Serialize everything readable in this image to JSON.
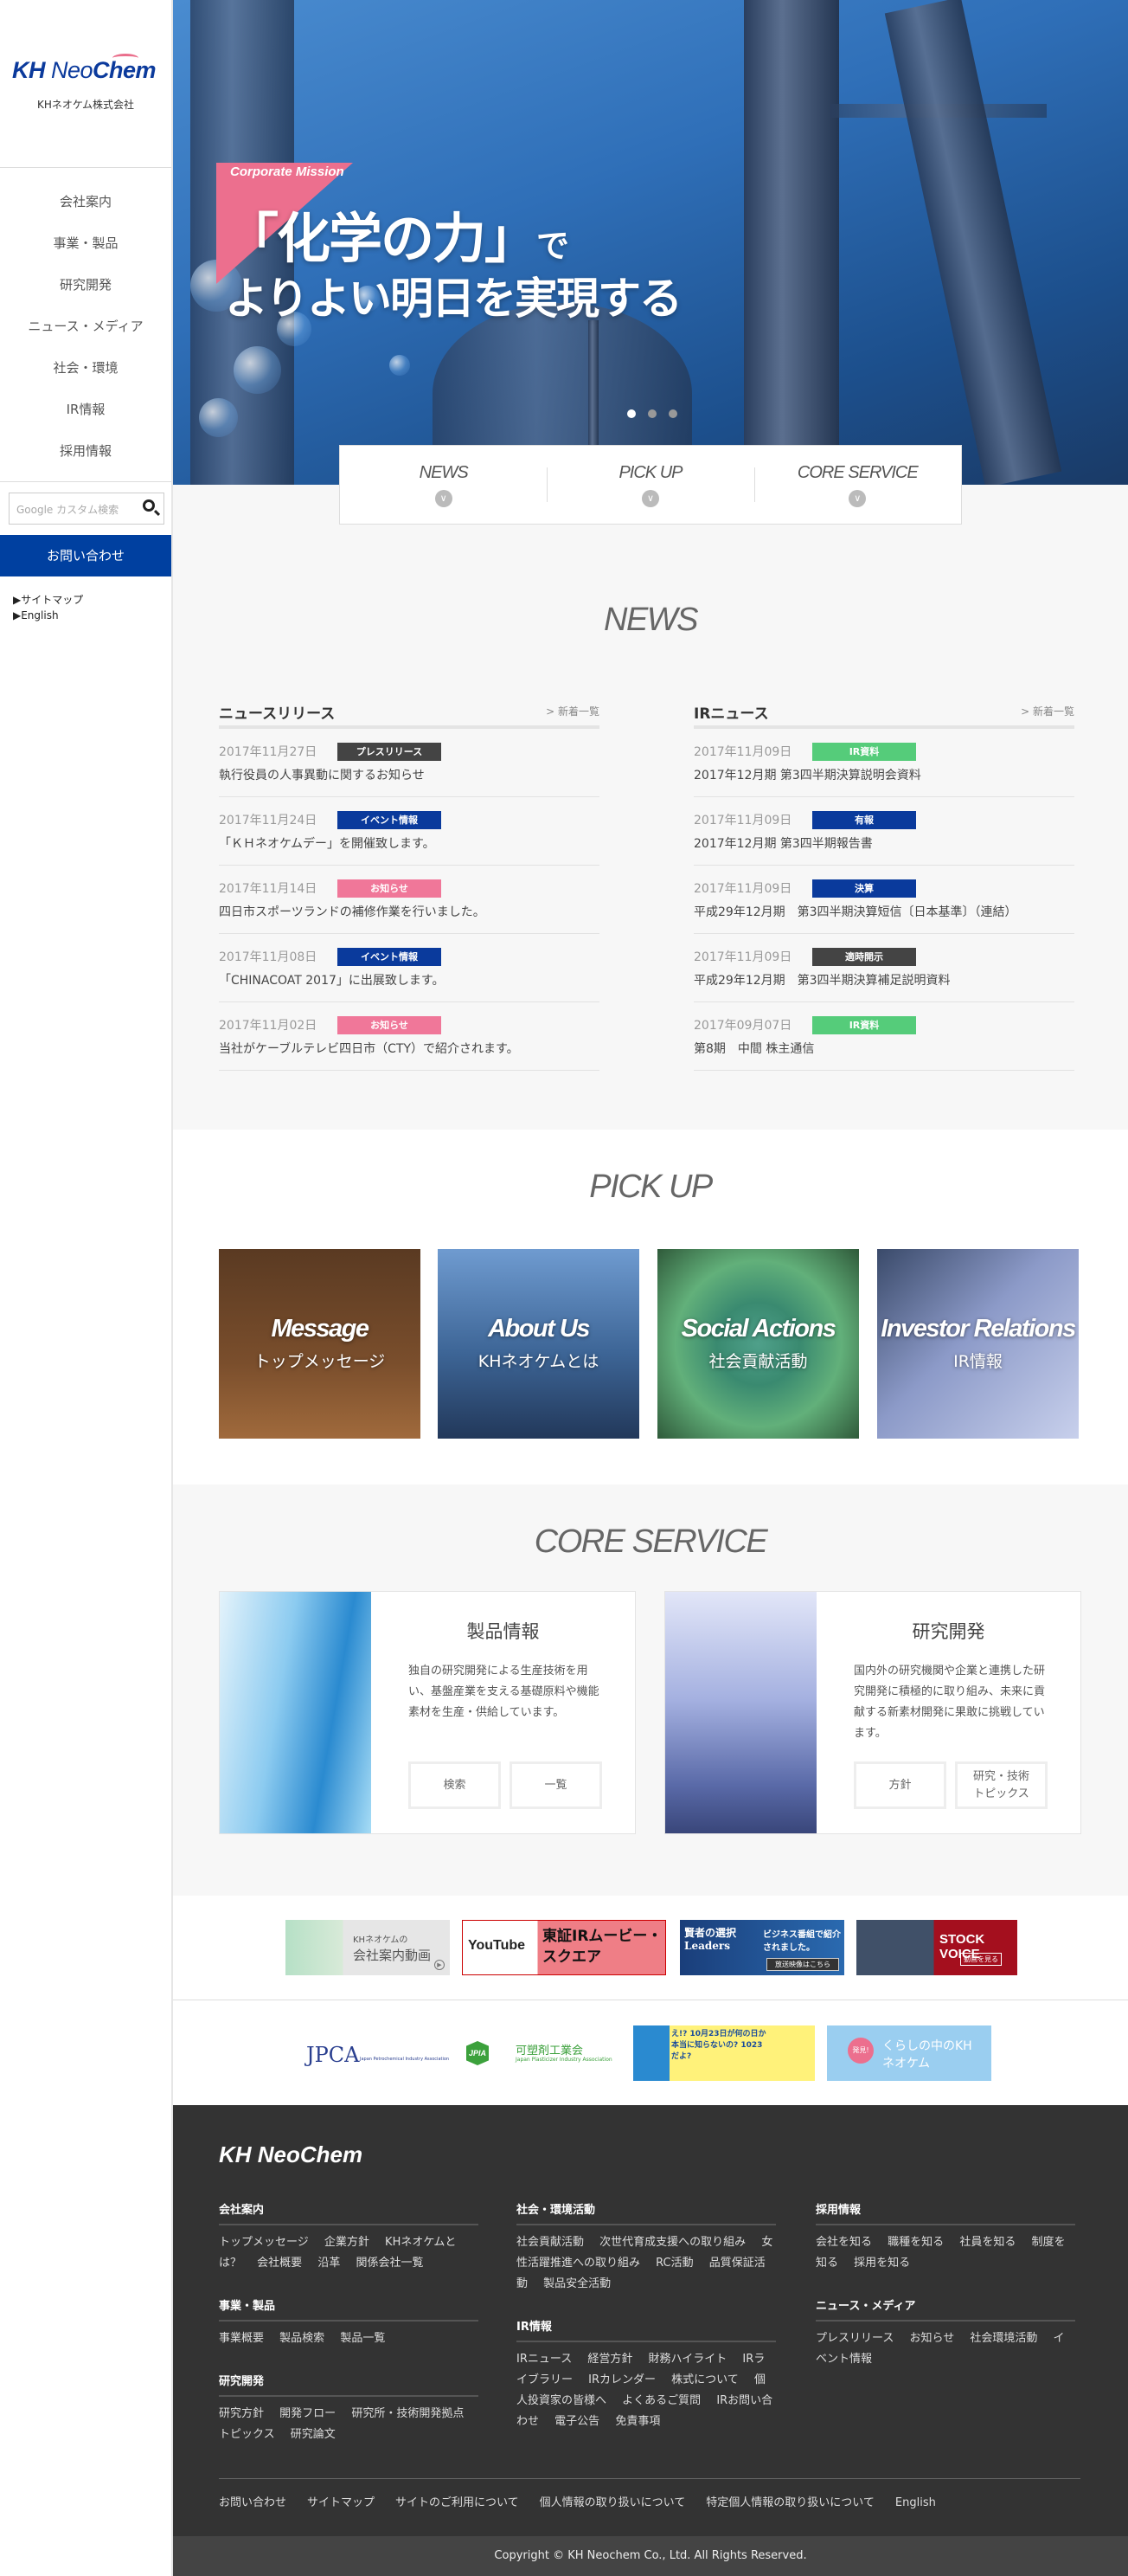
{
  "sidebar": {
    "logo_text": "KH NeoChem",
    "company_name": "KHネオケム株式会社",
    "nav": [
      "会社案内",
      "事業・製品",
      "研究開発",
      "ニュース・メディア",
      "社会・環境",
      "IR情報",
      "採用情報"
    ],
    "search_placeholder": "Google カスタム検索",
    "contact_label": "お問い合わせ",
    "links": [
      "▶サイトマップ",
      "▶English"
    ]
  },
  "hero": {
    "badge": "Corporate Mission",
    "line1_main": "「化学の力」",
    "line1_tail": "で",
    "line2": "よりよい明日を実現する",
    "slides": 3,
    "active_slide": 1
  },
  "tabs": [
    {
      "label": "NEWS"
    },
    {
      "label": "PICK UP"
    },
    {
      "label": "CORE SERVICE"
    }
  ],
  "news": {
    "title": "NEWS",
    "columns": [
      {
        "heading": "ニュースリリース",
        "more": "> 新着一覧",
        "items": [
          {
            "date": "2017年11月27日",
            "tag": "プレスリリース",
            "tag_color": "#444444",
            "title": "執行役員の人事異動に関するお知らせ"
          },
          {
            "date": "2017年11月24日",
            "tag": "イベント情報",
            "tag_color": "#0a3a9c",
            "title": "「ＫＨネオケムデー」を開催致します。"
          },
          {
            "date": "2017年11月14日",
            "tag": "お知らせ",
            "tag_color": "#f07799",
            "title": "四日市スポーツランドの補修作業を行いました。"
          },
          {
            "date": "2017年11月08日",
            "tag": "イベント情報",
            "tag_color": "#0a3a9c",
            "title": "「CHINACOAT 2017」に出展致します。"
          },
          {
            "date": "2017年11月02日",
            "tag": "お知らせ",
            "tag_color": "#f07799",
            "title": "当社がケーブルテレビ四日市（CTY）で紹介されます。"
          }
        ]
      },
      {
        "heading": "IRニュース",
        "more": "> 新着一覧",
        "items": [
          {
            "date": "2017年11月09日",
            "tag": "IR資料",
            "tag_color": "#55cc7a",
            "title": "2017年12月期 第3四半期決算説明会資料"
          },
          {
            "date": "2017年11月09日",
            "tag": "有報",
            "tag_color": "#0a3a9c",
            "title": "2017年12月期 第3四半期報告書"
          },
          {
            "date": "2017年11月09日",
            "tag": "決算",
            "tag_color": "#0a3a9c",
            "title": "平成29年12月期　第3四半期決算短信〔日本基準〕（連結）"
          },
          {
            "date": "2017年11月09日",
            "tag": "適時開示",
            "tag_color": "#444444",
            "title": "平成29年12月期　第3四半期決算補足説明資料"
          },
          {
            "date": "2017年09月07日",
            "tag": "IR資料",
            "tag_color": "#55cc7a",
            "title": "第8期　中間 株主通信"
          }
        ]
      }
    ]
  },
  "pickup": {
    "title": "PICK UP",
    "cards": [
      {
        "en": "Message",
        "jp": "トップメッセージ"
      },
      {
        "en": "About Us",
        "jp": "KHネオケムとは"
      },
      {
        "en": "Social Actions",
        "jp": "社会貢献活動"
      },
      {
        "en": "Investor Relations",
        "jp": "IR情報"
      }
    ]
  },
  "core": {
    "title": "CORE SERVICE",
    "cards": [
      {
        "heading": "製品情報",
        "text": "独自の研究開発による生産技術を用い、基盤産業を支える基礎原料や機能素材を生産・供給しています。",
        "buttons": [
          "検索",
          "一覧"
        ]
      },
      {
        "heading": "研究開発",
        "text": "国内外の研究機関や企業と連携した研究開発に積極的に取り組み、未来に貢献する新素材開発に果敢に挑戦しています。",
        "buttons": [
          "方針",
          "研究・技術トピックス"
        ]
      }
    ]
  },
  "banners": {
    "row1": [
      {
        "small": "KHネオケムの",
        "big": "会社案内動画"
      },
      {
        "logo": "YouTube",
        "text": "東証IRムービー・スクエア"
      },
      {
        "title": "賢者の選択 Leaders",
        "text": "ビジネス番組で紹介されました。",
        "button": "放送映像はこちら"
      },
      {
        "title": "STOCK VOICE",
        "button": "動画を見る"
      }
    ],
    "row2": [
      {
        "abbr": "JPCA",
        "name": "Japan Petrochemical Industry Association"
      },
      {
        "abbr": "JPIA",
        "name": "可塑剤工業会",
        "sub": "Japan Plasticizer Industry Association"
      },
      {
        "text": "え!? 10月23日が何の日か本当に知らないの? 1023だよ?"
      },
      {
        "badge": "発見!",
        "text": "くらしの中のKHネオケム"
      }
    ]
  },
  "footer": {
    "logo_text": "KH NeoChem",
    "columns": [
      [
        {
          "heading": "会社案内",
          "links": [
            "トップメッセージ",
            "企業方針",
            "KHネオケムとは？",
            "会社概要",
            "沿革",
            "関係会社一覧"
          ]
        },
        {
          "heading": "事業・製品",
          "links": [
            "事業概要",
            "製品検索",
            "製品一覧"
          ]
        },
        {
          "heading": "研究開発",
          "links": [
            "研究方針",
            "開発フロー",
            "研究所・技術開発拠点",
            "トピックス",
            "研究論文"
          ]
        }
      ],
      [
        {
          "heading": "社会・環境活動",
          "links": [
            "社会貢献活動",
            "次世代育成支援への取り組み",
            "女性活躍推進への取り組み",
            "RC活動",
            "品質保証活動",
            "製品安全活動"
          ]
        },
        {
          "heading": "IR情報",
          "links": [
            "IRニュース",
            "経営方針",
            "財務ハイライト",
            "IRライブラリー",
            "IRカレンダー",
            "株式について",
            "個人投資家の皆様へ",
            "よくあるご質問",
            "IRお問い合わせ",
            "電子公告",
            "免責事項"
          ]
        }
      ],
      [
        {
          "heading": "採用情報",
          "links": [
            "会社を知る",
            "職種を知る",
            "社員を知る",
            "制度を知る",
            "採用を知る"
          ]
        },
        {
          "heading": "ニュース・メディア",
          "links": [
            "プレスリリース",
            "お知らせ",
            "社会環境活動",
            "イベント情報"
          ]
        }
      ]
    ],
    "bottom_links": [
      "お問い合わせ",
      "サイトマップ",
      "サイトのご利用について",
      "個人情報の取り扱いについて",
      "特定個人情報の取り扱いについて",
      "English"
    ],
    "copyright": "Copyright © KH Neochem Co., Ltd. All Rights Reserved."
  },
  "colors": {
    "brand_blue": "#0040a0",
    "accent_pink": "#ec6f8e",
    "footer_bg": "#333333"
  }
}
